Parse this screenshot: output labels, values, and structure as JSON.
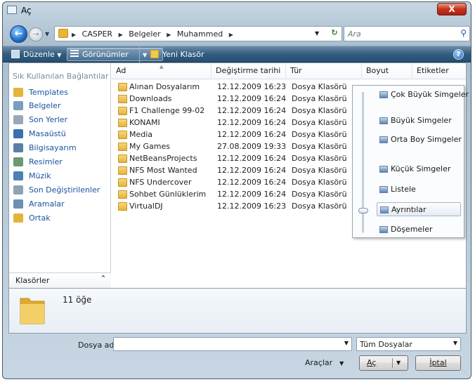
{
  "window": {
    "title": "Aç",
    "close_label": "X"
  },
  "nav": {
    "back_icon": "back-arrow-icon",
    "forward_icon": "forward-arrow-icon",
    "breadcrumb": [
      "CASPER",
      "Belgeler",
      "Muhammed"
    ],
    "search_placeholder": "Ara"
  },
  "toolbar": {
    "organize_label": "Düzenle",
    "views_label": "Görünümler",
    "new_folder_label": "Yeni Klasör",
    "help_label": "?"
  },
  "sidebar": {
    "header": "Sık Kullanılan Bağlantılar",
    "items": [
      {
        "label": "Templates",
        "icon": "folder-icon"
      },
      {
        "label": "Belgeler",
        "icon": "documents-icon"
      },
      {
        "label": "Son Yerler",
        "icon": "recent-places-icon"
      },
      {
        "label": "Masaüstü",
        "icon": "desktop-icon"
      },
      {
        "label": "Bilgisayarım",
        "icon": "computer-icon"
      },
      {
        "label": "Resimler",
        "icon": "pictures-icon"
      },
      {
        "label": "Müzik",
        "icon": "music-icon"
      },
      {
        "label": "Son Değiştirilenler",
        "icon": "recently-changed-icon"
      },
      {
        "label": "Aramalar",
        "icon": "searches-icon"
      },
      {
        "label": "Ortak",
        "icon": "public-folder-icon"
      }
    ],
    "footer_label": "Klasörler"
  },
  "columns": {
    "name": "Ad",
    "date": "Değiştirme tarihi",
    "type": "Tür",
    "size": "Boyut",
    "tags": "Etiketler"
  },
  "files": [
    {
      "name": "Alınan Dosyalarım",
      "date": "12.12.2009 16:23",
      "type": "Dosya Klasörü"
    },
    {
      "name": "Downloads",
      "date": "12.12.2009 16:24",
      "type": "Dosya Klasörü"
    },
    {
      "name": "F1 Challenge 99-02",
      "date": "12.12.2009 16:24",
      "type": "Dosya Klasörü"
    },
    {
      "name": "KONAMI",
      "date": "12.12.2009 16:24",
      "type": "Dosya Klasörü"
    },
    {
      "name": "Media",
      "date": "12.12.2009 16:24",
      "type": "Dosya Klasörü"
    },
    {
      "name": "My Games",
      "date": "27.08.2009 19:33",
      "type": "Dosya Klasörü"
    },
    {
      "name": "NetBeansProjects",
      "date": "12.12.2009 16:24",
      "type": "Dosya Klasörü"
    },
    {
      "name": "NFS Most Wanted",
      "date": "12.12.2009 16:24",
      "type": "Dosya Klasörü"
    },
    {
      "name": "NFS Undercover",
      "date": "12.12.2009 16:24",
      "type": "Dosya Klasörü"
    },
    {
      "name": "Sohbet Günlüklerim",
      "date": "12.12.2009 16:24",
      "type": "Dosya Klasörü"
    },
    {
      "name": "VirtualDJ",
      "date": "12.12.2009 16:23",
      "type": "Dosya Klasörü"
    }
  ],
  "views_menu": {
    "items": [
      {
        "label": "Çok Büyük Simgeler"
      },
      {
        "label": "Büyük Simgeler"
      },
      {
        "label": "Orta Boy Simgeler"
      },
      {
        "label": "Küçük Simgeler"
      },
      {
        "label": "Listele"
      },
      {
        "label": "Ayrıntılar",
        "selected": true
      },
      {
        "label": "Döşemeler"
      }
    ]
  },
  "details": {
    "count": "11 öğe"
  },
  "bottom": {
    "filename_label": "Dosya adı:",
    "filename_value": "",
    "filter_value": "Tüm Dosyalar",
    "tools_label": "Araçlar",
    "open_label": "Aç",
    "cancel_label": "İptal"
  },
  "colors": {
    "toolbar": "#2f587c",
    "link": "#1a53a0",
    "folder": "#e6b33a"
  }
}
